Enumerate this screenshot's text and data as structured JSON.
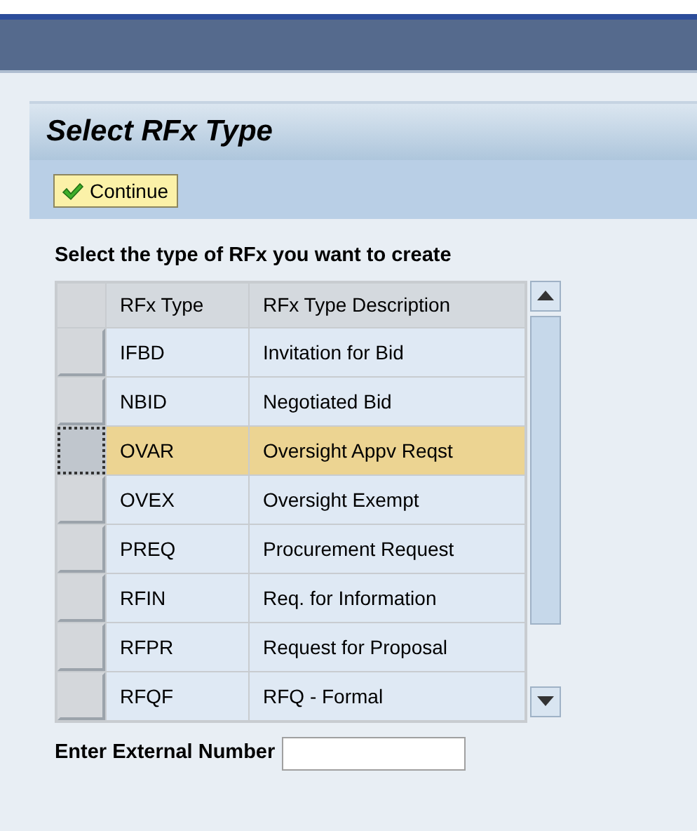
{
  "dialog": {
    "title": "Select RFx Type"
  },
  "toolbar": {
    "buttons": [
      {
        "label": "Continue"
      }
    ]
  },
  "instruction": "Select the type of RFx you want to create",
  "table": {
    "columns": [
      "RFx Type",
      "RFx Type Description"
    ],
    "rows": [
      {
        "cells": [
          "IFBD",
          "Invitation for Bid"
        ],
        "selected": false
      },
      {
        "cells": [
          "NBID",
          "Negotiated Bid"
        ],
        "selected": false
      },
      {
        "cells": [
          "OVAR",
          "Oversight Appv Reqst"
        ],
        "selected": true
      },
      {
        "cells": [
          "OVEX",
          "Oversight Exempt"
        ],
        "selected": false
      },
      {
        "cells": [
          "PREQ",
          "Procurement Request"
        ],
        "selected": false
      },
      {
        "cells": [
          "RFIN",
          "Req. for Information"
        ],
        "selected": false
      },
      {
        "cells": [
          "RFPR",
          "Request for Proposal"
        ],
        "selected": false
      },
      {
        "cells": [
          "RFQF",
          "RFQ - Formal"
        ],
        "selected": false
      }
    ]
  },
  "external_number": {
    "label": "Enter External Number"
  }
}
